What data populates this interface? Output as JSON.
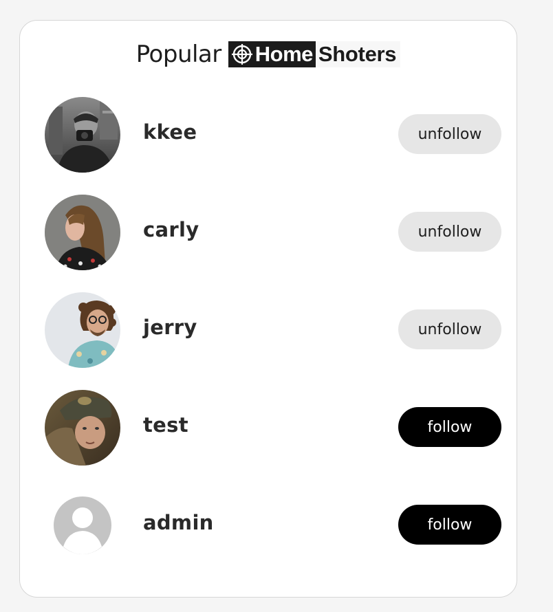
{
  "header": {
    "title": "Popular",
    "logo_part1": "Home",
    "logo_part2": "Shoters"
  },
  "users": [
    {
      "username": "kkee",
      "button_label": "unfollow",
      "button_state": "unfollow",
      "avatar": "photo-man-with-camera"
    },
    {
      "username": "carly",
      "button_label": "unfollow",
      "button_state": "unfollow",
      "avatar": "photo-woman-long-hair"
    },
    {
      "username": "jerry",
      "button_label": "unfollow",
      "button_state": "unfollow",
      "avatar": "photo-man-curly-hair-glasses"
    },
    {
      "username": "test",
      "button_label": "follow",
      "button_state": "follow",
      "avatar": "photo-person-with-cap"
    },
    {
      "username": "admin",
      "button_label": "follow",
      "button_state": "follow",
      "avatar": "default-user-icon"
    }
  ],
  "colors": {
    "follow_bg": "#000000",
    "follow_text": "#ffffff",
    "unfollow_bg": "#e6e6e6",
    "unfollow_text": "#1e1e1e"
  }
}
